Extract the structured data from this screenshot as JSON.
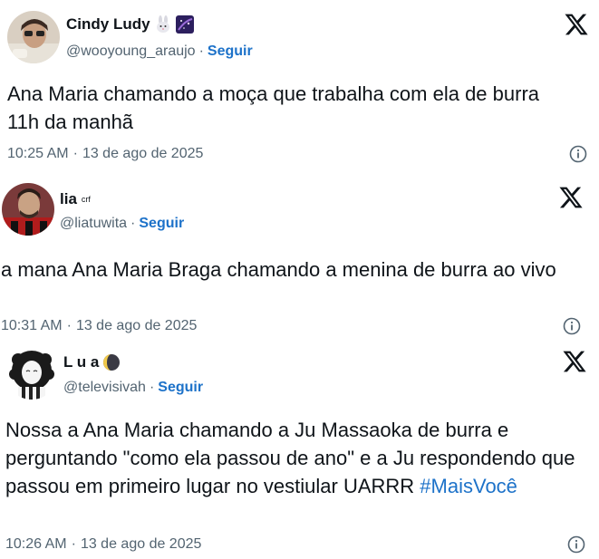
{
  "tweets": [
    {
      "display_name": "Cindy Ludy",
      "handle": "@wooyoung_araujo",
      "follow_label": "Seguir",
      "text": "Ana Maria chamando a moça que trabalha com ela de burra 11h da manhã",
      "time": "10:25 AM",
      "date": "13 de ago de 2025",
      "name_icons": [
        "rabbit-icon",
        "galaxy-icon"
      ]
    },
    {
      "display_name": "lia",
      "name_suffix": "crf",
      "handle": "@liatuwita",
      "follow_label": "Seguir",
      "text": "a mana Ana Maria Braga chamando a menina de burra ao vivo",
      "time": "10:31 AM",
      "date": "13 de ago de 2025"
    },
    {
      "display_name": "L u a",
      "handle": "@televisivah",
      "follow_label": "Seguir",
      "text": "Nossa a Ana Maria chamando a Ju Massaoka de burra e perguntando \"como ela passou de ano\" e a Ju respondendo que passou em primeiro lugar no vestiular UARRR",
      "hashtag": "#MaisVocê",
      "time": "10:26 AM",
      "date": "13 de ago de 2025",
      "name_icons": [
        "moon-icon"
      ]
    }
  ],
  "separator": "·",
  "colors": {
    "link": "#1d72c9",
    "secondary": "#536471",
    "text": "#0f1419"
  }
}
